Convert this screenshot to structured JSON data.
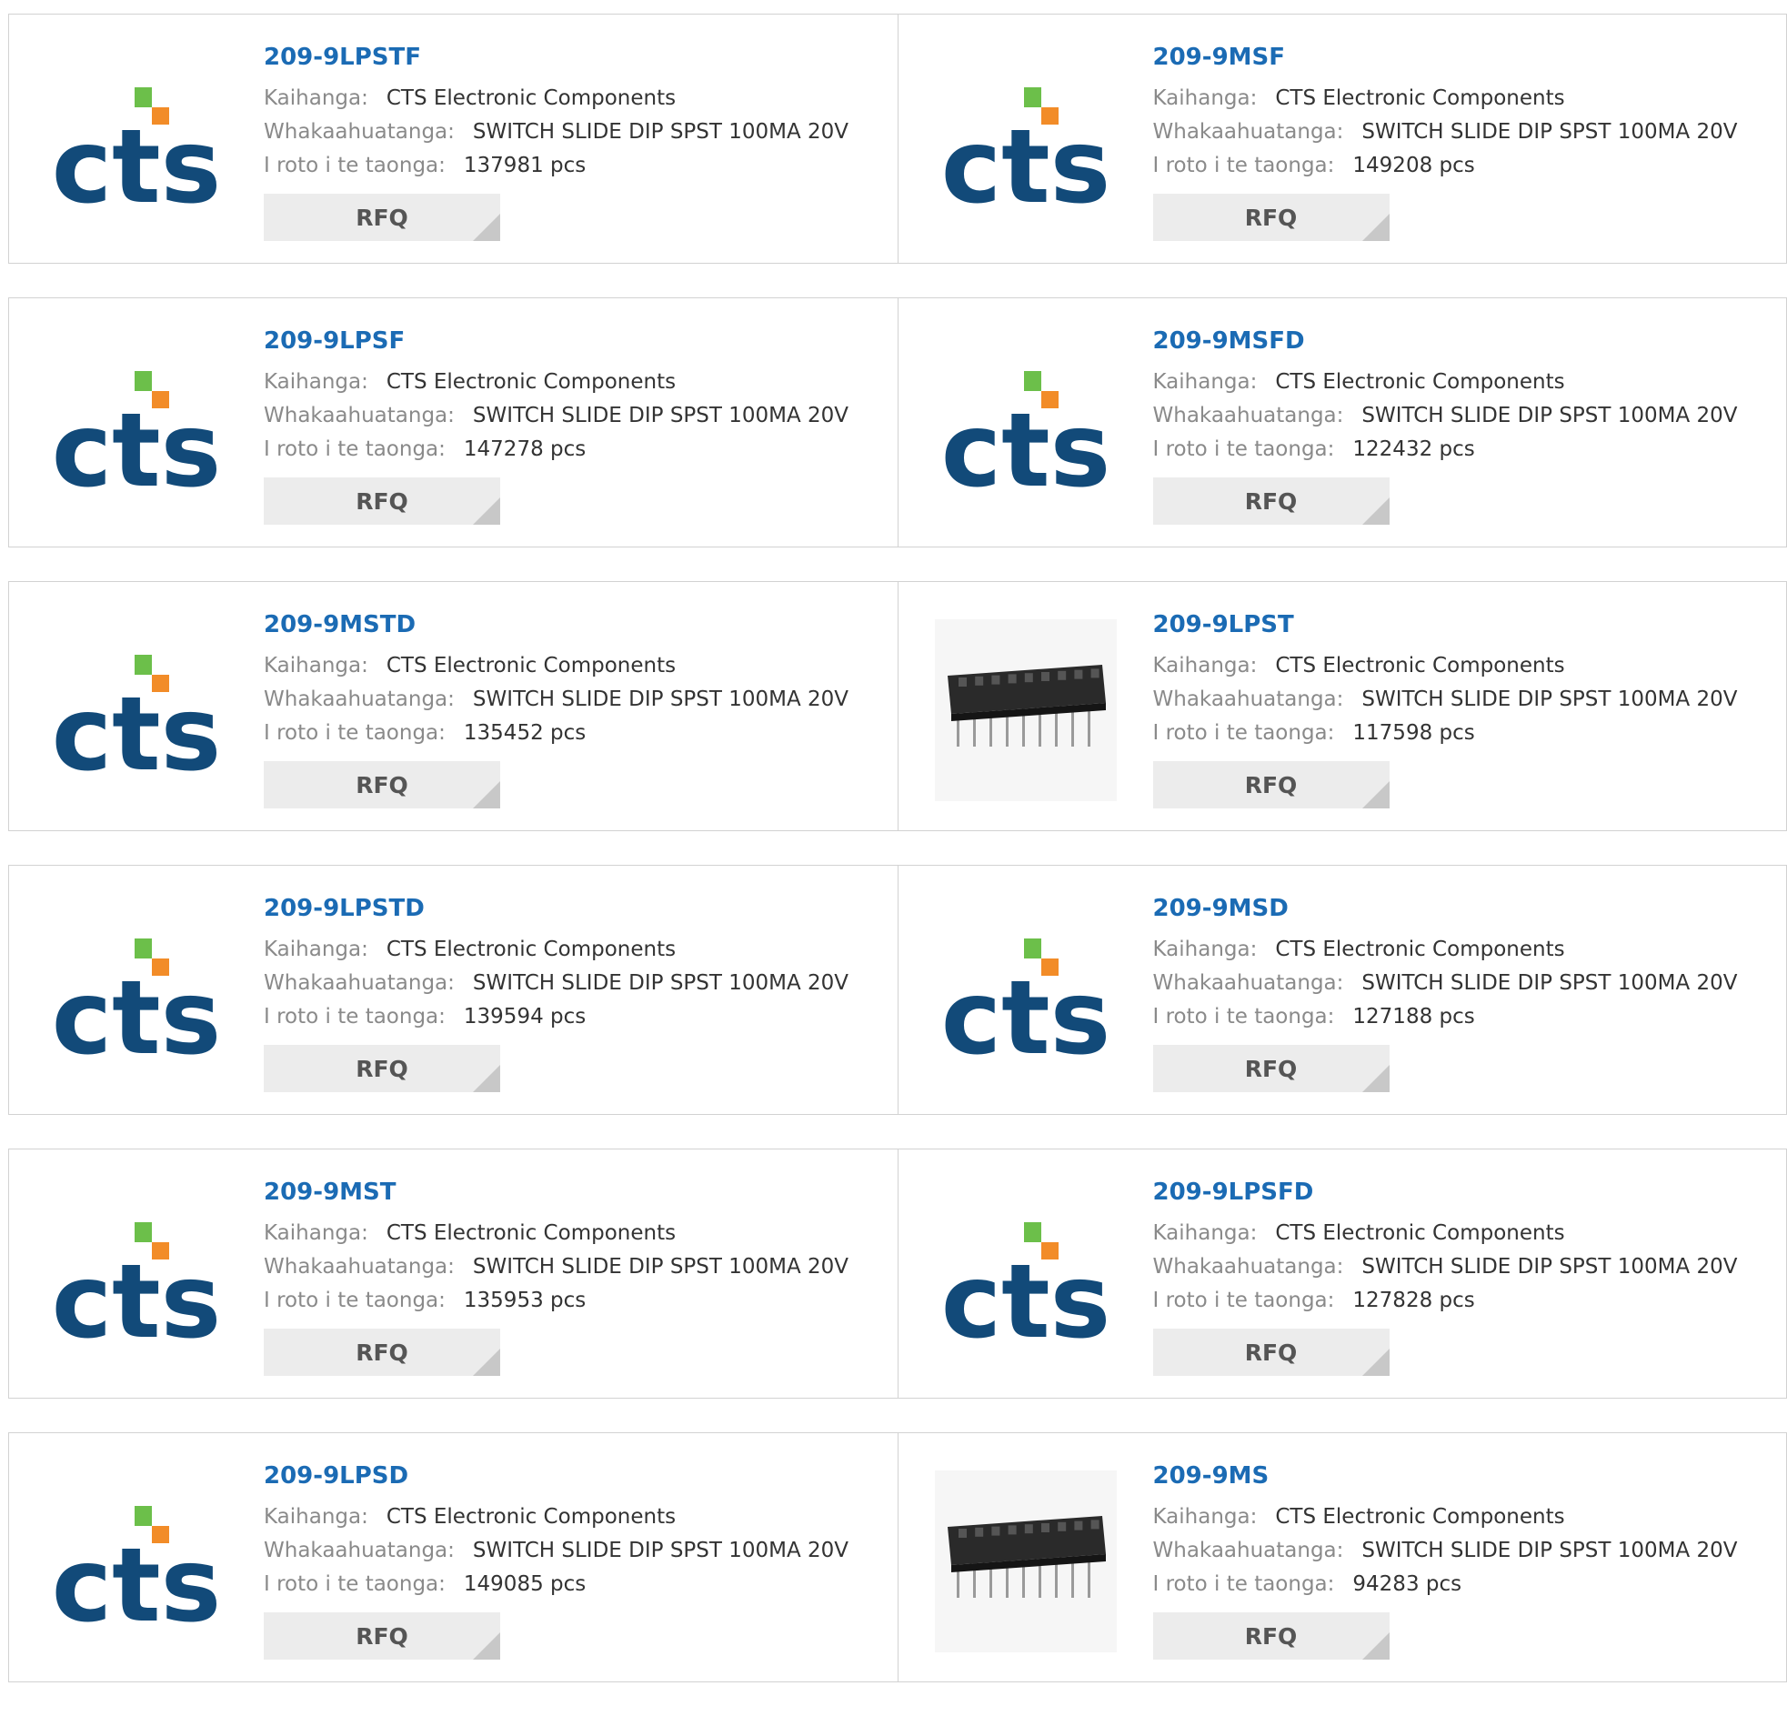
{
  "labels": {
    "manufacturer": "Kaihanga:",
    "description": "Whakaahuatanga:",
    "stock": "I roto i te taonga:",
    "rfq": "RFQ"
  },
  "products": [
    {
      "part": "209-9LPSTF",
      "manufacturer": "CTS Electronic Components",
      "description": "SWITCH SLIDE DIP SPST 100MA 20V",
      "stock": "137981 pcs",
      "image": "cts-logo"
    },
    {
      "part": "209-9MSF",
      "manufacturer": "CTS Electronic Components",
      "description": "SWITCH SLIDE DIP SPST 100MA 20V",
      "stock": "149208 pcs",
      "image": "cts-logo"
    },
    {
      "part": "209-9LPSF",
      "manufacturer": "CTS Electronic Components",
      "description": "SWITCH SLIDE DIP SPST 100MA 20V",
      "stock": "147278 pcs",
      "image": "cts-logo"
    },
    {
      "part": "209-9MSFD",
      "manufacturer": "CTS Electronic Components",
      "description": "SWITCH SLIDE DIP SPST 100MA 20V",
      "stock": "122432 pcs",
      "image": "cts-logo"
    },
    {
      "part": "209-9MSTD",
      "manufacturer": "CTS Electronic Components",
      "description": "SWITCH SLIDE DIP SPST 100MA 20V",
      "stock": "135452 pcs",
      "image": "cts-logo"
    },
    {
      "part": "209-9LPST",
      "manufacturer": "CTS Electronic Components",
      "description": "SWITCH SLIDE DIP SPST 100MA 20V",
      "stock": "117598 pcs",
      "image": "dip-switch-photo"
    },
    {
      "part": "209-9LPSTD",
      "manufacturer": "CTS Electronic Components",
      "description": "SWITCH SLIDE DIP SPST 100MA 20V",
      "stock": "139594 pcs",
      "image": "cts-logo"
    },
    {
      "part": "209-9MSD",
      "manufacturer": "CTS Electronic Components",
      "description": "SWITCH SLIDE DIP SPST 100MA 20V",
      "stock": "127188 pcs",
      "image": "cts-logo"
    },
    {
      "part": "209-9MST",
      "manufacturer": "CTS Electronic Components",
      "description": "SWITCH SLIDE DIP SPST 100MA 20V",
      "stock": "135953 pcs",
      "image": "cts-logo"
    },
    {
      "part": "209-9LPSFD",
      "manufacturer": "CTS Electronic Components",
      "description": "SWITCH SLIDE DIP SPST 100MA 20V",
      "stock": "127828 pcs",
      "image": "cts-logo"
    },
    {
      "part": "209-9LPSD",
      "manufacturer": "CTS Electronic Components",
      "description": "SWITCH SLIDE DIP SPST 100MA 20V",
      "stock": "149085 pcs",
      "image": "cts-logo"
    },
    {
      "part": "209-9MS",
      "manufacturer": "CTS Electronic Components",
      "description": "SWITCH SLIDE DIP SPST 100MA 20V",
      "stock": "94283 pcs",
      "image": "dip-switch-photo"
    }
  ],
  "logo": {
    "text": "cts",
    "colors": {
      "navy": "#124a79",
      "green": "#6cbf4a",
      "orange": "#f28c28"
    }
  }
}
